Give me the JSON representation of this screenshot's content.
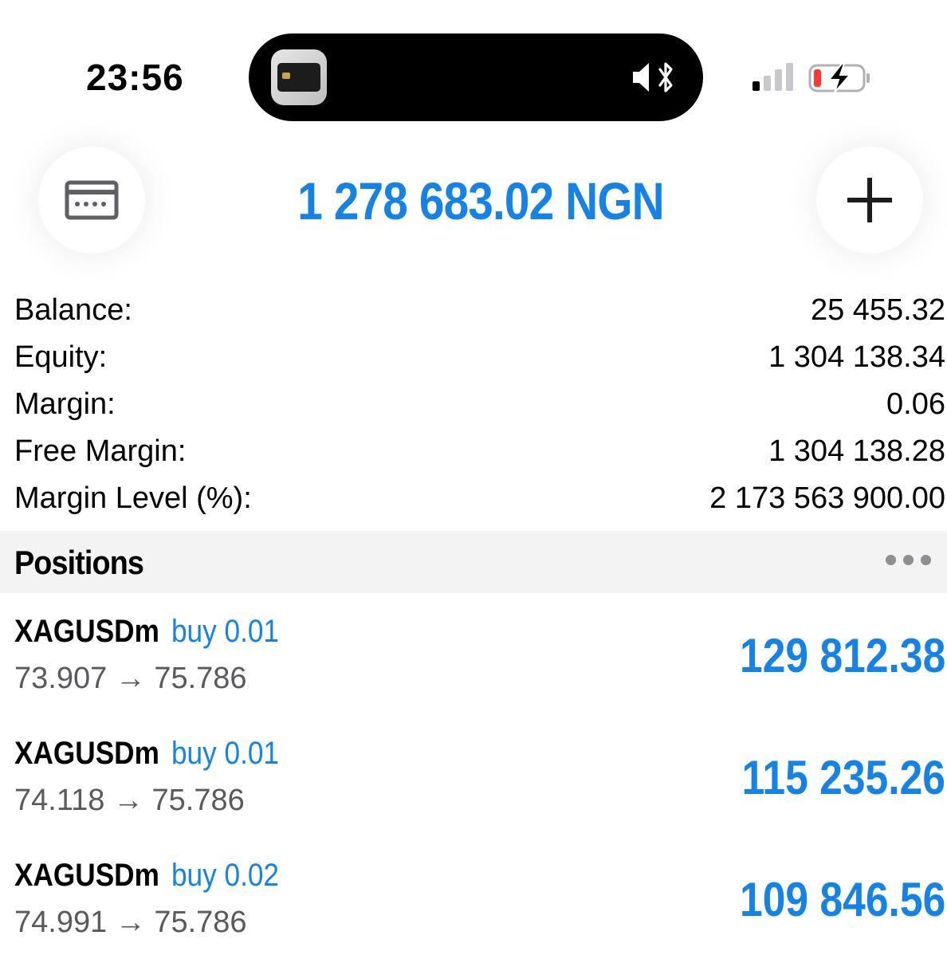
{
  "status_bar": {
    "time": "23:56",
    "icons": [
      "app-thumbnail-icon",
      "speaker-muted-icon",
      "bluetooth-icon",
      "cellular-signal-icon",
      "battery-charging-icon"
    ]
  },
  "header": {
    "equity_display": "1 278 683.02 NGN",
    "left_button_icon": "card-icon",
    "right_button_icon": "plus-icon"
  },
  "summary": [
    {
      "label": "Balance:",
      "value": "25 455.32"
    },
    {
      "label": "Equity:",
      "value": "1 304 138.34"
    },
    {
      "label": "Margin:",
      "value": "0.06"
    },
    {
      "label": "Free Margin:",
      "value": "1 304 138.28"
    },
    {
      "label": "Margin Level (%):",
      "value": "2 173 563 900.00"
    }
  ],
  "positions": {
    "title": "Positions",
    "items": [
      {
        "symbol": "XAGUSDm",
        "type": "buy 0.01",
        "prices": "73.907 → 75.786",
        "profit": "129 812.38"
      },
      {
        "symbol": "XAGUSDm",
        "type": "buy 0.01",
        "prices": "74.118 → 75.786",
        "profit": "115 235.26"
      },
      {
        "symbol": "XAGUSDm",
        "type": "buy 0.02",
        "prices": "74.991 → 75.786",
        "profit": "109 846.56"
      }
    ]
  },
  "colors": {
    "accent": "#1482e6",
    "secondary_text": "#5a5a5e",
    "section_bg": "#f3f3f4"
  }
}
